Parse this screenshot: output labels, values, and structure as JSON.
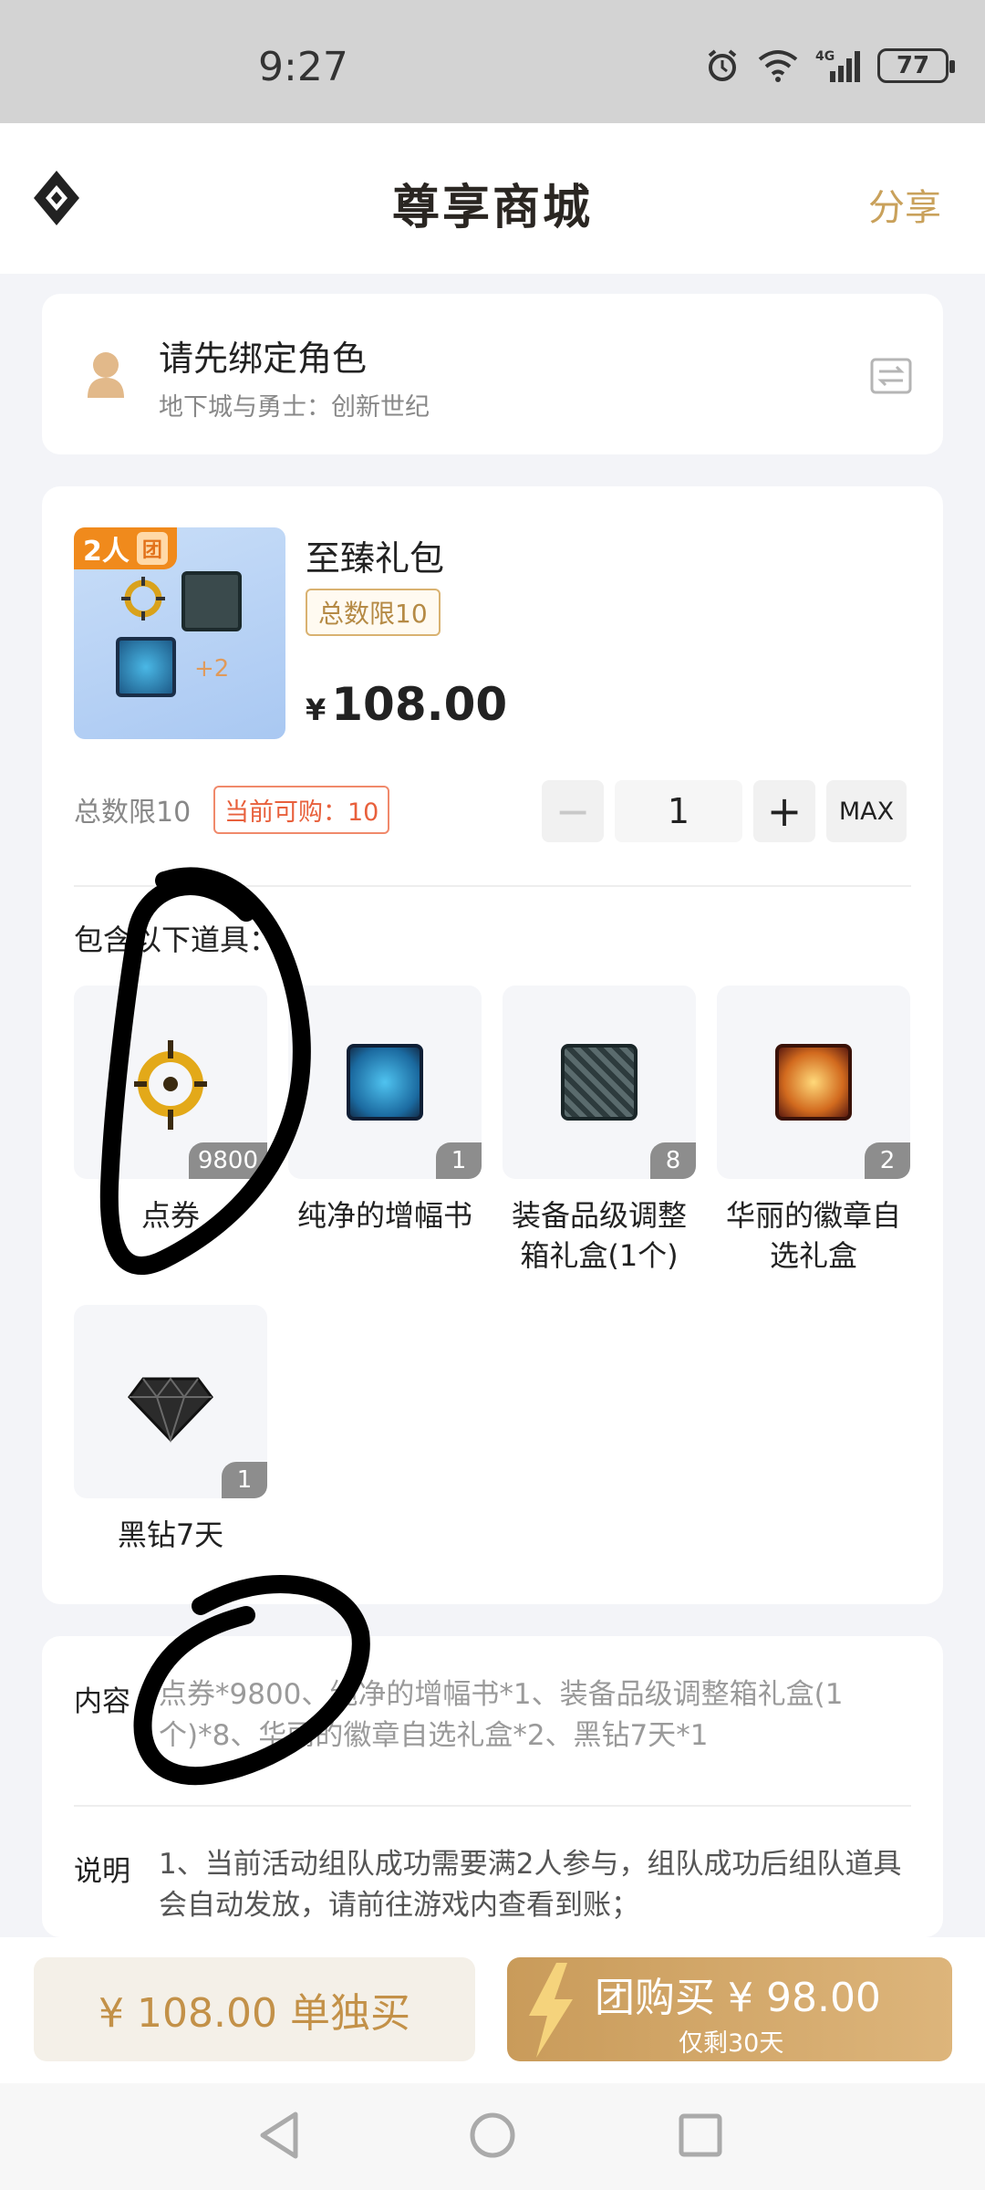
{
  "status": {
    "time": "9:27",
    "battery": "77"
  },
  "nav": {
    "title": "尊享商城",
    "share": "分享"
  },
  "role": {
    "title": "请先绑定角色",
    "subtitle": "地下城与勇士：创新世纪"
  },
  "product": {
    "tag": "2人",
    "tag_sub": "团",
    "thumb_extra": "+2",
    "name": "至臻礼包",
    "limit_badge": "总数限10",
    "currency": "¥",
    "price": "108.00",
    "limit_text": "总数限10",
    "can_buy": "当前可购：10",
    "quantity": "1",
    "max_label": "MAX",
    "contains_label": "包含以下道具："
  },
  "items": [
    {
      "name": "点券",
      "count": "9800",
      "icon": "coupon-icon"
    },
    {
      "name": "纯净的增幅书",
      "count": "1",
      "icon": "amplify-book-icon"
    },
    {
      "name": "装备品级调整箱礼盒(1个)",
      "count": "8",
      "icon": "grade-box-icon"
    },
    {
      "name": "华丽的徽章自选礼盒",
      "count": "2",
      "icon": "emblem-box-icon"
    },
    {
      "name": "黑钻7天",
      "count": "1",
      "icon": "black-diamond-icon"
    }
  ],
  "details": {
    "content_label": "内容",
    "content_text": "点券*9800、纯净的增幅书*1、装备品级调整箱礼盒(1个)*8、华丽的徽章自选礼盒*2、黑钻7天*1",
    "desc_label": "说明",
    "desc_text": "1、当前活动组队成功需要满2人参与，组队成功后组队道具会自动发放，请前往游戏内查看到账；"
  },
  "bottom": {
    "single_label": "¥ 108.00 单独买",
    "group_label": "团购买 ¥ 98.00",
    "group_sub": "仅剩30天"
  },
  "colors": {
    "accent_gold": "#c9a15b",
    "group_gradient": "#c99b5a",
    "warn": "#e8603c"
  }
}
